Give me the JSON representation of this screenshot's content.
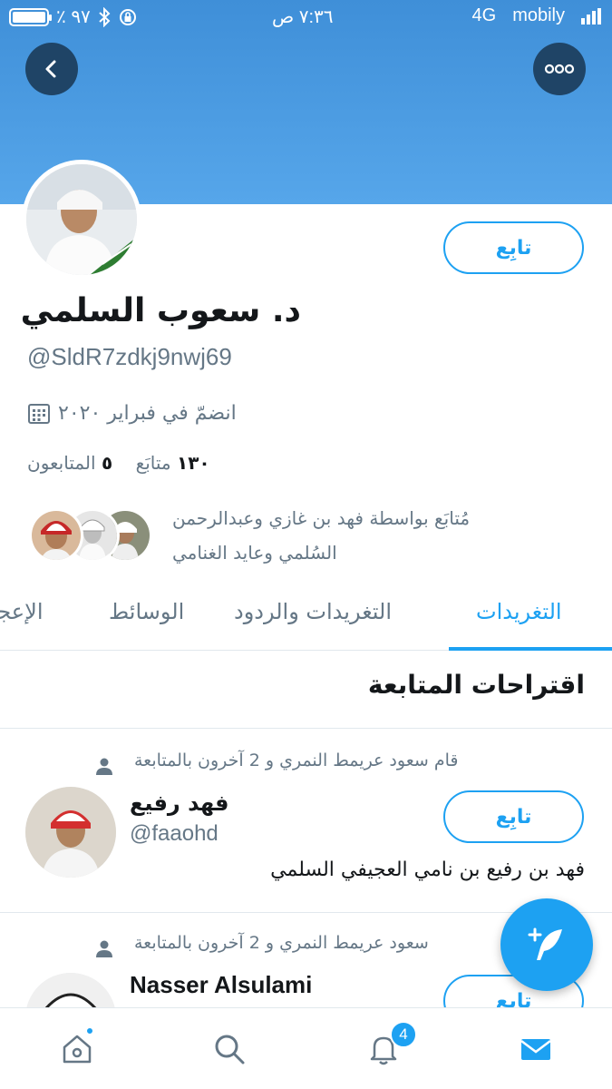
{
  "status_bar": {
    "battery": "٪ ٩٧",
    "time": "٧:٣٦ ص",
    "network": "4G",
    "carrier": "mobily"
  },
  "profile": {
    "name": "د. سعوب السلمي",
    "handle": "@SldR7zdkj9nwj69",
    "joined": "انضمّ في فبراير ٢٠٢٠",
    "following_count": "١٣٠",
    "following_label": "متابَع",
    "followers_count": "٥",
    "followers_label": "المتابعون",
    "followed_by_line1": "مُتابَع بواسطة فهد بن غازي وعبدالرحمن",
    "followed_by_line2": "السُلمي وعايد الغنامي",
    "follow_label": "تابِع"
  },
  "tabs": [
    {
      "label": "التغريدات",
      "active": true
    },
    {
      "label": "التغريدات والردود",
      "active": false
    },
    {
      "label": "الوسائط",
      "active": false
    },
    {
      "label": "الإعجا",
      "active": false
    }
  ],
  "suggestions": {
    "title": "اقتراحات المتابعة",
    "items": [
      {
        "context": "قام سعود عريمط النمري و 2 آخرون بالمتابعة",
        "name": "فهد رفيع",
        "handle": "@faaohd",
        "bio": "فهد بن رفيع بن نامي العجيفي السلمي",
        "follow_label": "تابِع"
      },
      {
        "context": "سعود عريمط النمري و 2 آخرون بالمتابعة",
        "name": "Nasser Alsulami",
        "handle": "",
        "bio": "",
        "follow_label": "تابِع"
      }
    ]
  },
  "bottom_nav": {
    "notifications_badge": "4"
  },
  "icons": {
    "back": "chevron-left-icon",
    "more": "more-dots-icon",
    "calendar": "calendar-icon",
    "person": "person-icon",
    "compose": "compose-tweet-icon",
    "home": "home-icon",
    "search": "search-icon",
    "notifications": "bell-icon",
    "messages": "envelope-icon"
  },
  "colors": {
    "accent": "#1da1f2",
    "banner": "#4a9be2",
    "dark_button": "#1f4466",
    "muted_text": "#657786"
  }
}
